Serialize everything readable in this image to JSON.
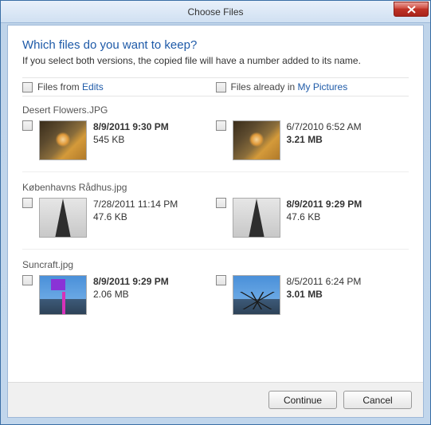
{
  "window": {
    "title": "Choose Files"
  },
  "heading": "Which files do you want to keep?",
  "subtext": "If you select both versions, the copied file will have a number added to its name.",
  "columns": {
    "left_prefix": "Files from ",
    "left_link": "Edits",
    "right_prefix": "Files already in ",
    "right_link": "My Pictures"
  },
  "files": [
    {
      "name": "Desert Flowers.JPG",
      "left": {
        "date": "8/9/2011 9:30 PM",
        "size": "545 KB",
        "date_newer": true,
        "size_newer": false
      },
      "right": {
        "date": "6/7/2010 6:52 AM",
        "size": "3.21 MB",
        "date_newer": false,
        "size_newer": true
      }
    },
    {
      "name": "Københavns Rådhus.jpg",
      "left": {
        "date": "7/28/2011 11:14 PM",
        "size": "47.6 KB",
        "date_newer": false,
        "size_newer": false
      },
      "right": {
        "date": "8/9/2011 9:29 PM",
        "size": "47.6 KB",
        "date_newer": true,
        "size_newer": false
      }
    },
    {
      "name": "Suncraft.jpg",
      "left": {
        "date": "8/9/2011 9:29 PM",
        "size": "2.06 MB",
        "date_newer": true,
        "size_newer": false
      },
      "right": {
        "date": "8/5/2011 6:24 PM",
        "size": "3.01 MB",
        "date_newer": false,
        "size_newer": true
      }
    }
  ],
  "buttons": {
    "continue": "Continue",
    "cancel": "Cancel"
  }
}
